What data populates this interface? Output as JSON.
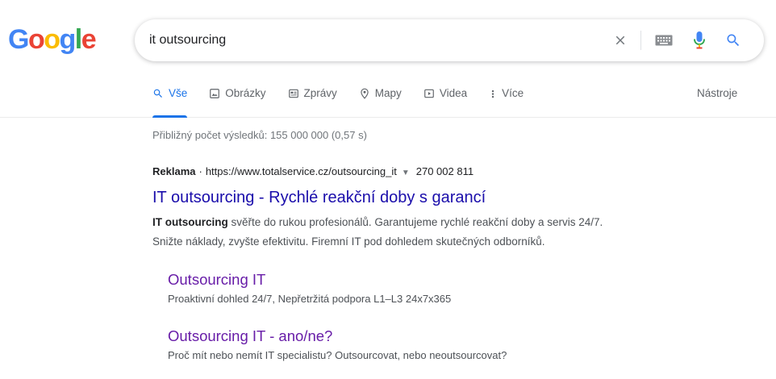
{
  "logo": {
    "letters": [
      "G",
      "o",
      "o",
      "g",
      "l",
      "e"
    ],
    "colors": [
      "#4285F4",
      "#EA4335",
      "#FBBC05",
      "#4285F4",
      "#34A853",
      "#EA4335"
    ]
  },
  "search": {
    "query": "it outsourcing"
  },
  "tabs": [
    {
      "label": "Vše",
      "icon": "search-icon",
      "active": true
    },
    {
      "label": "Obrázky",
      "icon": "image-icon",
      "active": false
    },
    {
      "label": "Zprávy",
      "icon": "news-icon",
      "active": false
    },
    {
      "label": "Mapy",
      "icon": "map-pin-icon",
      "active": false
    },
    {
      "label": "Videa",
      "icon": "video-icon",
      "active": false
    },
    {
      "label": "Více",
      "icon": "more-vert-icon",
      "active": false
    }
  ],
  "tools_label": "Nástroje",
  "stats": "Přibližný počet výsledků: 155 000 000 (0,57 s)",
  "ad": {
    "label": "Reklama",
    "separator": "·",
    "url": "https://www.totalservice.cz/outsourcing_it",
    "caret": "▼",
    "phone": "270 002 811",
    "title": "IT outsourcing - Rychlé reakční doby s garancí",
    "desc_bold": "IT outsourcing",
    "desc_line1": " svěřte do rukou profesionálů. Garantujeme rychlé reakční doby a servis 24/7.",
    "desc_line2": "Snižte náklady, zvyšte efektivitu. Firemní IT pod dohledem skutečných odborníků.",
    "sitelinks": [
      {
        "title": "Outsourcing IT",
        "desc": "Proaktivní dohled 24/7, Nepřetržitá podpora L1–L3 24x7x365"
      },
      {
        "title": "Outsourcing IT - ano/ne?",
        "desc": "Proč mít nebo nemít IT specialistu? Outsourcovat, nebo neoutsourcovat?"
      }
    ]
  },
  "colors": {
    "accent": "#1a73e8",
    "link": "#1a0dab",
    "visited": "#681da8"
  }
}
